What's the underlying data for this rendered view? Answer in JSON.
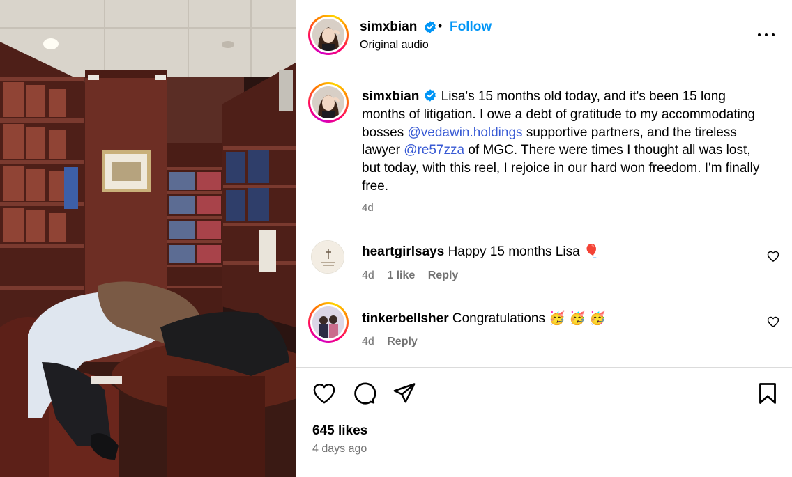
{
  "post": {
    "username": "simxbian",
    "follow_label": "Follow",
    "separator": "•",
    "audio_label": "Original audio"
  },
  "caption": {
    "username": "simxbian",
    "text_1": "Lisa's 15 months old today, and it's been 15 long months of litigation. I owe a debt of gratitude to my accommodating bosses ",
    "mention_1": "@vedawin.holdings",
    "text_2": " supportive partners, and the tireless lawyer ",
    "mention_2": "@re57zza",
    "text_3": " of MGC. There were times I thought all was lost, but today, with this reel, I rejoice in our hard won freedom. I'm finally free.",
    "time": "4d"
  },
  "comments": [
    {
      "username": "heartgirlsays",
      "text": "Happy 15 months Lisa 🎈",
      "time": "4d",
      "likes": "1 like",
      "reply_label": "Reply"
    },
    {
      "username": "tinkerbellsher",
      "text": "Congratulations 🥳 🥳 🥳",
      "time": "4d",
      "reply_label": "Reply"
    }
  ],
  "footer": {
    "likes": "645 likes",
    "posted": "4 days ago"
  },
  "icons": {
    "verified": "verified-badge-icon",
    "more": "more-options-icon",
    "like": "heart-icon",
    "comment": "comment-bubble-icon",
    "share": "paper-plane-icon",
    "save": "bookmark-icon"
  },
  "colors": {
    "link": "#0095f6",
    "mention": "#385ad4",
    "secondary_text": "#737373",
    "divider": "#dbdbdb"
  }
}
